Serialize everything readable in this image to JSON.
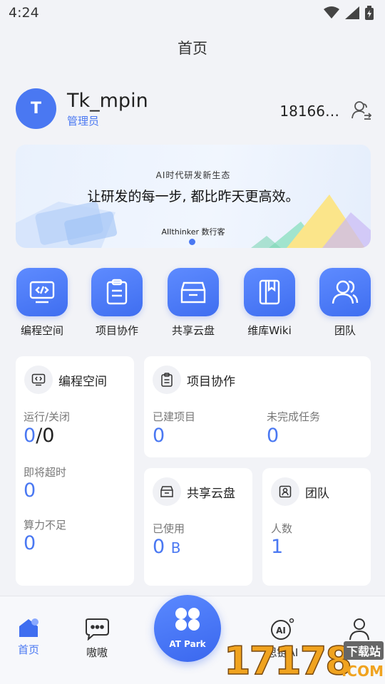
{
  "status_bar": {
    "time": "4:24",
    "icons": [
      "wifi-icon",
      "signal-icon",
      "battery-icon"
    ]
  },
  "header": {
    "title": "首页"
  },
  "profile": {
    "avatar_letter": "T",
    "username": "Tk_mpin",
    "role": "管理员",
    "phone": "18166…",
    "switch_icon": "switch-user-icon"
  },
  "banner": {
    "subtitle": "AI时代研发新生态",
    "headline": "让研发的每一步, 都比昨天更高效。",
    "brand": "AIIthinker 数行客",
    "page_indicator": {
      "current": 1
    }
  },
  "quick_entries": [
    {
      "label": "编程空间",
      "icon": "code-icon"
    },
    {
      "label": "项目协作",
      "icon": "clipboard-icon"
    },
    {
      "label": "共享云盘",
      "icon": "box-icon"
    },
    {
      "label": "维库Wiki",
      "icon": "book-icon"
    },
    {
      "label": "团队",
      "icon": "team-icon"
    }
  ],
  "cards": {
    "coding": {
      "title": "编程空间",
      "running_label": "运行/关闭",
      "running_value": "0",
      "closed_value": "0",
      "timeout_label": "即将超时",
      "timeout_value": "0",
      "compute_label": "算力不足",
      "compute_value": "0"
    },
    "project": {
      "title": "项目协作",
      "created_label": "已建项目",
      "created_value": "0",
      "unfinished_label": "未完成任务",
      "unfinished_value": "0"
    },
    "disk": {
      "title": "共享云盘",
      "used_label": "已使用",
      "used_value": "0",
      "used_unit": "B"
    },
    "team": {
      "title": "团队",
      "members_label": "人数",
      "members_value": "1"
    }
  },
  "tabbar": {
    "tabs": [
      {
        "label": "首页",
        "icon": "home-icon",
        "active": true
      },
      {
        "label": "嗷嗷",
        "icon": "chat-icon"
      },
      {
        "label": "AT Park",
        "icon": "park-icon"
      },
      {
        "label": "思链AI",
        "icon": "ai-icon"
      },
      {
        "label": "我的",
        "icon": "profile-icon"
      }
    ]
  },
  "watermark": {
    "text": "17178",
    "domain": ".COM",
    "tag": "下载站"
  },
  "colors": {
    "accent": "#4a78f2",
    "background": "#f2f3f7"
  }
}
